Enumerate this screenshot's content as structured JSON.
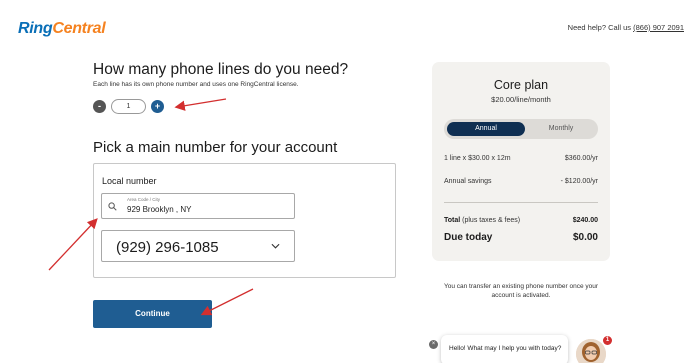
{
  "header": {
    "logo_part1": "Ring",
    "logo_part2": "Central",
    "help_text": "Need help? Call us",
    "help_phone": "(866) 907 2091"
  },
  "lines": {
    "title": "How many phone lines do you need?",
    "subtitle": "Each line has its own phone number and uses one RingCentral license.",
    "minus": "-",
    "plus": "+",
    "quantity": "1"
  },
  "number": {
    "title": "Pick a main number for your account",
    "local_label": "Local number",
    "area_tiny_label": "Area Code / City",
    "area_value": "929 Brooklyn , NY",
    "selected_number": "(929) 296-1085"
  },
  "continue_label": "Continue",
  "plan": {
    "title": "Core plan",
    "price": "$20.00/line/month",
    "toggle_annual": "Annual",
    "toggle_monthly": "Monthly",
    "line_calc": "1 line x $30.00 x 12m",
    "line_calc_value": "$360.00/yr",
    "savings_label": "Annual savings",
    "savings_value": "- $120.00/yr",
    "total_label_bold": "Total",
    "total_label_rest": " (plus taxes & fees)",
    "total_value": "$240.00",
    "due_label": "Due today",
    "due_value": "$0.00"
  },
  "transfer_note": "You can transfer an existing phone number once your account is activated.",
  "chat": {
    "message": "Hello! What may I help you with today?",
    "close": "×",
    "badge": "1"
  },
  "colors": {
    "brand_blue": "#0a6fb7",
    "brand_orange": "#f58220",
    "button_blue": "#1f5d92",
    "toggle_dark": "#0f2f52",
    "annotation_red": "#d32f2f"
  }
}
